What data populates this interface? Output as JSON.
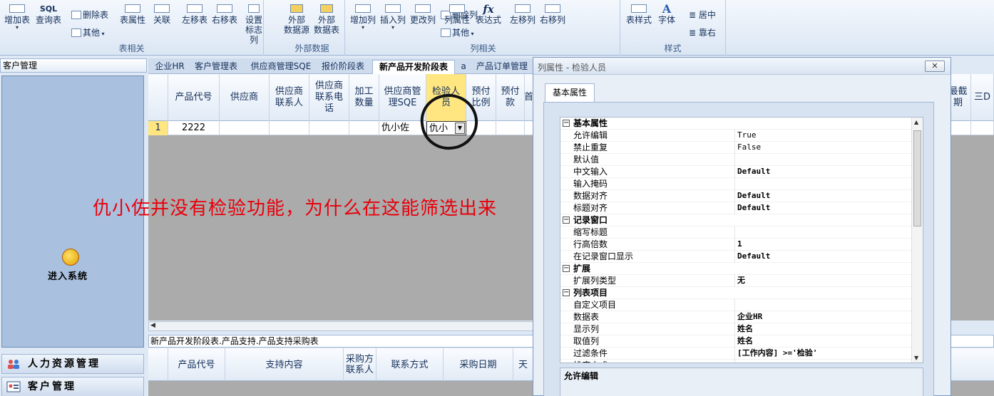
{
  "ribbon": {
    "group1": {
      "buttons": [
        "增加表",
        "查询表"
      ],
      "small": [
        "删除表",
        "其他"
      ],
      "big2": [
        "表属性",
        "关联"
      ],
      "moves": [
        "左移表",
        "右移表"
      ],
      "setflag": "设置\n标志列",
      "label": "表相关",
      "top_hint": "SQL"
    },
    "group2": {
      "buttons": [
        "外部\n数据源",
        "外部\n数据表"
      ],
      "label": "外部数据"
    },
    "group3": {
      "buttons": [
        "增加列",
        "插入列",
        "更改列",
        "列属性",
        "表达式",
        "左移列",
        "右移列"
      ],
      "small": [
        "删除列",
        "其他"
      ],
      "fx": "fx",
      "label": "列相关"
    },
    "group4": {
      "buttons": [
        "表样式",
        "字体"
      ],
      "small": [
        "居中",
        "靠右"
      ],
      "label": "样式"
    }
  },
  "left": {
    "title": "客户管理",
    "enter_label": "进入系统",
    "nav": [
      {
        "label": "人力资源管理"
      },
      {
        "label": "客户管理"
      }
    ]
  },
  "tabs": [
    "企业HR",
    "客户管理表",
    "供应商管理SQE",
    "报价阶段表",
    "新产品开发阶段表",
    "a",
    "产品订单管理"
  ],
  "grid": {
    "headers": [
      "产品代号",
      "供应商",
      "供应商\n联系人",
      "供应商\n联系电\n话",
      "加工\n数量",
      "供应商管\n理SQE",
      "检验人\n员",
      "预付\n比例",
      "预付\n款",
      "首",
      "最截\n期",
      "三D"
    ],
    "row": {
      "rowno": "1",
      "product_code": "2222",
      "sqe": "仇小佐",
      "inspector": "仇小"
    }
  },
  "subtable": {
    "title": "新产品开发阶段表.产品支持.产品支持采购表",
    "headers": [
      "产品代号",
      "支持内容",
      "采购方\n联系人",
      "联系方式",
      "采购日期",
      "天"
    ]
  },
  "annotation": "仇小佐并没有检验功能，为什么在这能筛选出来",
  "dialog": {
    "title": "列属性 - 检验人员",
    "close": "✕",
    "tab": "基本属性",
    "categories": [
      {
        "name": "基本属性",
        "rows": [
          {
            "name": "允许编辑",
            "value": "True",
            "bold": false
          },
          {
            "name": "禁止重复",
            "value": "False",
            "bold": false
          },
          {
            "name": "默认值",
            "value": "",
            "bold": false
          },
          {
            "name": "中文输入",
            "value": "Default",
            "bold": true
          },
          {
            "name": "输入掩码",
            "value": "",
            "bold": false
          },
          {
            "name": "数据对齐",
            "value": "Default",
            "bold": true
          },
          {
            "name": "标题对齐",
            "value": "Default",
            "bold": true
          }
        ]
      },
      {
        "name": "记录窗口",
        "rows": [
          {
            "name": "缩写标题",
            "value": "",
            "bold": false
          },
          {
            "name": "行高倍数",
            "value": "1",
            "bold": true
          },
          {
            "name": "在记录窗口显示",
            "value": "Default",
            "bold": true
          }
        ]
      },
      {
        "name": "扩展",
        "rows": [
          {
            "name": "扩展列类型",
            "value": "无",
            "bold": true
          }
        ]
      },
      {
        "name": "列表项目",
        "rows": [
          {
            "name": "自定义项目",
            "value": "",
            "bold": false
          },
          {
            "name": "数据表",
            "value": "企业HR",
            "bold": true
          },
          {
            "name": "显示列",
            "value": "姓名",
            "bold": true
          },
          {
            "name": "取值列",
            "value": "姓名",
            "bold": true
          },
          {
            "name": "过滤条件",
            "value": "[工作内容] >='检验'",
            "bold": true
          },
          {
            "name": "排序方式",
            "value": "",
            "bold": false
          }
        ]
      }
    ],
    "desc_title": "允许编辑"
  },
  "colors": {
    "highlight": "#ffe680",
    "annotation": "#e8000b"
  }
}
